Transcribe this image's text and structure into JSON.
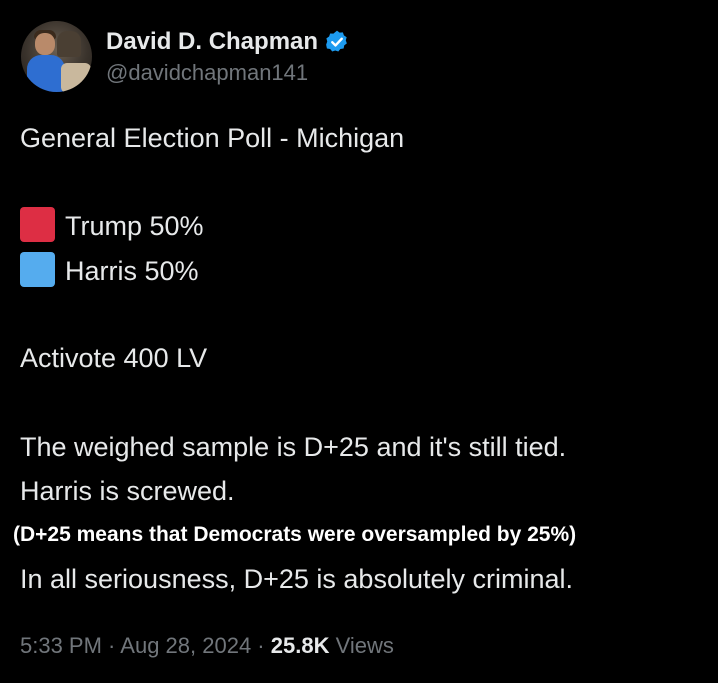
{
  "author": {
    "display_name": "David D. Chapman",
    "handle": "@davidchapman141"
  },
  "tweet": {
    "title_line": "General Election Poll - Michigan",
    "poll": [
      {
        "label": "Trump 50%",
        "color": "#dd2e44",
        "icon": "red-square"
      },
      {
        "label": "Harris 50%",
        "color": "#55acee",
        "icon": "blue-square"
      }
    ],
    "source": "Activote 400 LV",
    "line1": "The weighed sample is D+25 and it's still tied.",
    "line2": "Harris is screwed.",
    "note": "(D+25 means that Democrats were oversampled by 25%)",
    "line3": "In all seriousness, D+25 is absolutely criminal."
  },
  "meta": {
    "time": "5:33 PM",
    "sep1": " · ",
    "date": "Aug 28, 2024",
    "sep2": " · ",
    "views_count": "25.8K",
    "views_label": " Views"
  }
}
